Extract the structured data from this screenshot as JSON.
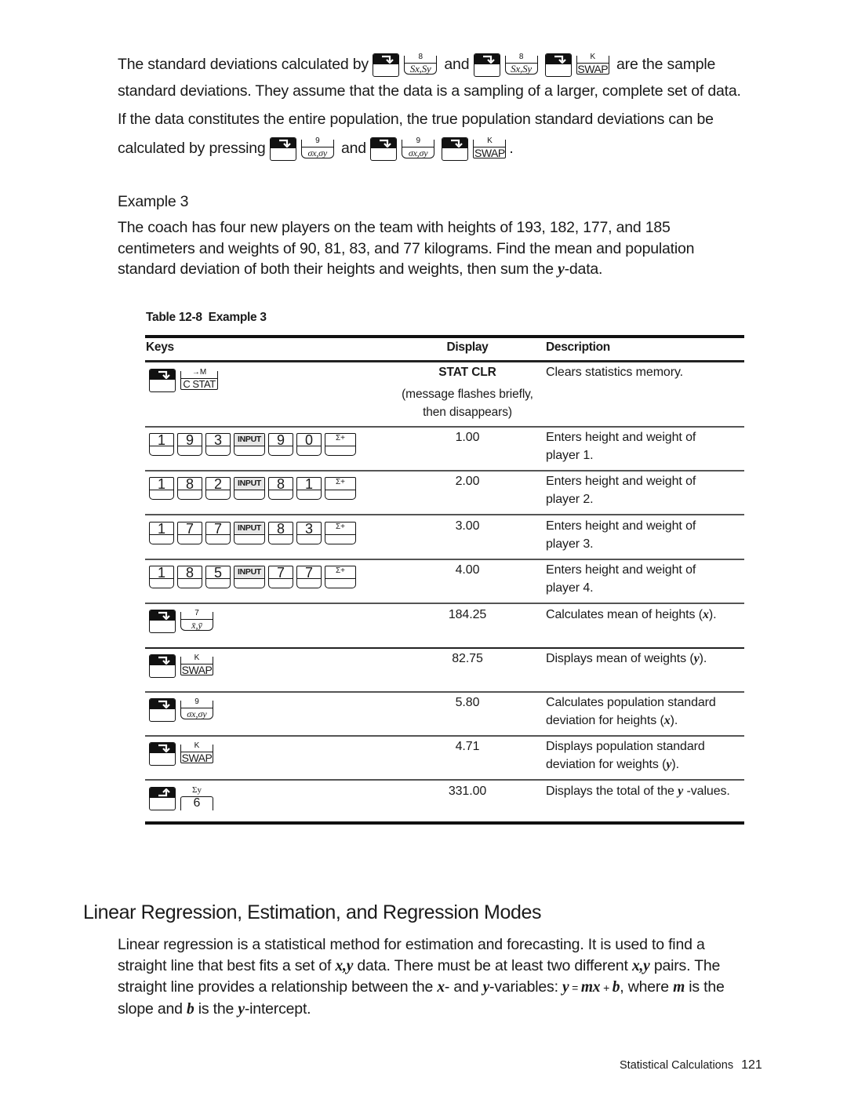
{
  "intro": {
    "line1_pre": "The standard deviations calculated by",
    "line1_and": "and",
    "line1_post": "are the sample",
    "line2": "standard deviations. They assume that the data is a sampling of a larger, complete set of data.",
    "line3": "If the data constitutes the entire population, the true population standard deviations can be",
    "line4_pre": "calculated by pressing",
    "line4_and": "and",
    "line4_post": "."
  },
  "keys_legend": {
    "shift_right": "right-shift",
    "sxsy_top": "8",
    "sxsy_main": "Sx,Sy",
    "swap_top": "K",
    "swap_main": "SWAP",
    "sigma_top": "9",
    "sigma_main": "σx,σy",
    "mean_top": "7",
    "mean_main": "x̄,ȳ",
    "cstat_top": "→M",
    "cstat_main": "C STAT",
    "input": "INPUT",
    "sigma_plus": "Σ+",
    "sumy_sup": "Σy",
    "sumy_main": "6"
  },
  "example": {
    "heading": "Example 3",
    "text1": "The coach has four new players on the team with heights of 193, 182, 177, and 185",
    "text2": "centimeters and weights of 90, 81, 83, and 77 kilograms. Find the mean and population",
    "text3_pre": "standard deviation of both their heights and weights, then sum the ",
    "text3_var": "y",
    "text3_post": "-data."
  },
  "table": {
    "caption": "Table 12-8  Example 3",
    "headers": {
      "keys": "Keys",
      "display": "Display",
      "description": "Description"
    },
    "rows": [
      {
        "keys": [
          "right-shift",
          "C STAT"
        ],
        "display": "STAT CLR",
        "display_note1": "(message flashes briefly,",
        "display_note2": "then disappears)",
        "desc1": "Clears statistics memory.",
        "desc2": ""
      },
      {
        "keys": [
          "1",
          "9",
          "3",
          "INPUT",
          "9",
          "0",
          "Σ+"
        ],
        "display": "1.00",
        "desc1": "Enters height and weight of",
        "desc2": "player 1."
      },
      {
        "keys": [
          "1",
          "8",
          "2",
          "INPUT",
          "8",
          "1",
          "Σ+"
        ],
        "display": "2.00",
        "desc1": "Enters height and weight of",
        "desc2": "player 2."
      },
      {
        "keys": [
          "1",
          "7",
          "7",
          "INPUT",
          "8",
          "3",
          "Σ+"
        ],
        "display": "3.00",
        "desc1": "Enters height and weight of",
        "desc2": "player 3."
      },
      {
        "keys": [
          "1",
          "8",
          "5",
          "INPUT",
          "7",
          "7",
          "Σ+"
        ],
        "display": "4.00",
        "desc1": "Enters height and weight of",
        "desc2": "player 4."
      },
      {
        "keys": [
          "right-shift",
          "x̄,ȳ"
        ],
        "display": "184.25",
        "desc1_pre": "Calculates mean of heights (",
        "desc1_var": "x",
        "desc1_post": ")."
      },
      {
        "keys": [
          "right-shift",
          "SWAP"
        ],
        "display": "82.75",
        "desc1_pre": "Displays mean of weights (",
        "desc1_var": "y",
        "desc1_post": ")."
      },
      {
        "keys": [
          "right-shift",
          "σx,σy"
        ],
        "display": "5.80",
        "desc1": "Calculates population standard",
        "desc2_pre": "deviation for heights (",
        "desc2_var": "x",
        "desc2_post": ")."
      },
      {
        "keys": [
          "right-shift",
          "SWAP"
        ],
        "display": "4.71",
        "desc1": "Displays population standard",
        "desc2_pre": "deviation for weights (",
        "desc2_var": "y",
        "desc2_post": ")."
      },
      {
        "keys": [
          "left-shift",
          "Σy"
        ],
        "display": "331.00",
        "desc1_pre": "Displays the total of the ",
        "desc1_var": "y",
        "desc1_post": " -values."
      }
    ]
  },
  "section": {
    "title": "Linear Regression, Estimation, and Regression Modes",
    "p1": "Linear regression is a statistical method for estimation and forecasting. It is used to find a",
    "p2_a": "straight line that best fits a set of ",
    "p2_b": "x,y",
    "p2_c": " data. There must be at least two different ",
    "p2_d": "x,y",
    "p2_e": " pairs. The",
    "p3_a": "straight line provides a relationship between the ",
    "p3_b": "x",
    "p3_c": "- and ",
    "p3_d": "y",
    "p3_e": "-variables: ",
    "p3_f": "y",
    "p3_g": " = ",
    "p3_h": "mx",
    "p3_i": " + ",
    "p3_j": "b",
    "p3_k": ", where ",
    "p3_l": "m",
    "p3_m": " is the",
    "p4_a": "slope and ",
    "p4_b": "b",
    "p4_c": " is the ",
    "p4_d": "y",
    "p4_e": "-intercept."
  },
  "footer": {
    "chapter": "Statistical Calculations",
    "page": "121"
  }
}
